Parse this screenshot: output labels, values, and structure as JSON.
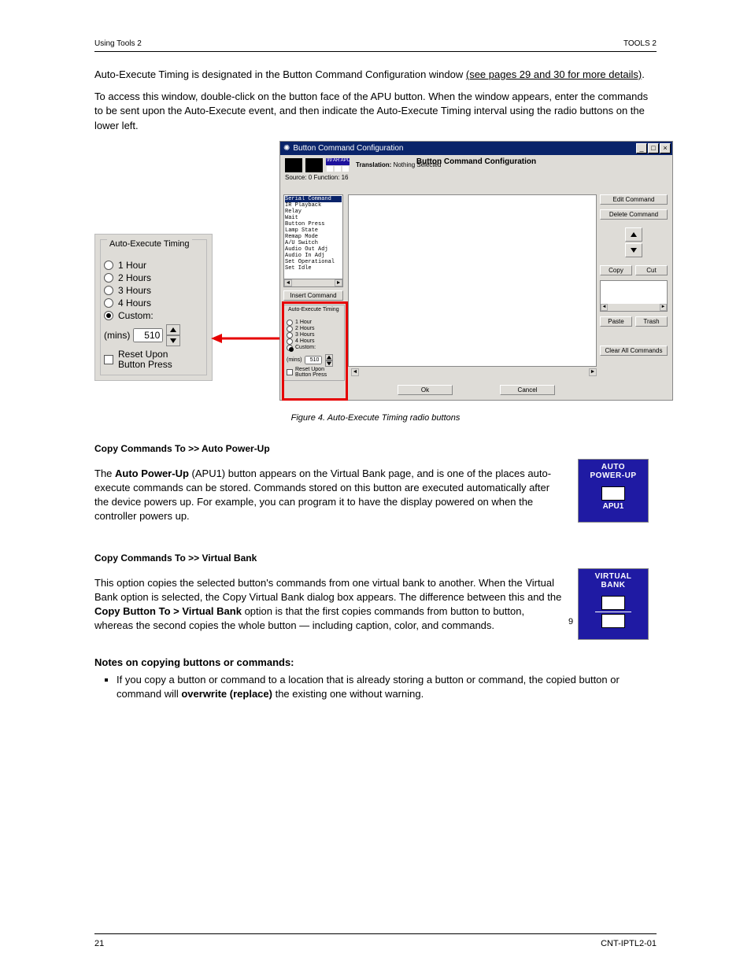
{
  "header": {
    "left": "Using Tools 2",
    "right": "TOOLS 2"
  },
  "intro": {
    "line1_pre": "Auto-Execute Timing is designated in the Button Command Configuration window ",
    "line1_link": "(see pages 29 and 30 for more details)",
    "line1_post": ".",
    "line2": "To access this window, double-click on the button face of the APU button. When the window appears, enter the commands to be sent upon the Auto-Execute event, and then indicate the Auto-Execute Timing interval using the radio buttons on the lower left."
  },
  "timing": {
    "title": "Auto-Execute Timing",
    "opts": [
      "1 Hour",
      "2 Hours",
      "3 Hours",
      "4 Hours",
      "Custom:"
    ],
    "selected": 4,
    "mins_label": "(mins)",
    "mins_value": "510",
    "reset_label": "Reset Upon\nButton Press"
  },
  "dialog": {
    "titlebar": "Button Command Configuration",
    "big_title": "Button Command Configuration",
    "sel_badge": "99 AR APU",
    "translation_label": "Translation:",
    "translation_value": "Nothing Selected",
    "subline": "Source: 0    Function: 16",
    "commands": [
      "Serial Command",
      "IR Playback",
      "Relay",
      "Wait",
      "Button Press",
      "Lamp State",
      "Remap Mode",
      "A/U Switch",
      "Audio Out Adj",
      "Audio In Adj",
      "Set Operational",
      "Set Idle"
    ],
    "insert": "Insert Command",
    "edit": "Edit Command",
    "del": "Delete Command",
    "copy": "Copy",
    "cut": "Cut",
    "paste": "Paste",
    "trash": "Trash",
    "clear": "Clear All Commands",
    "ok": "Ok",
    "cancel": "Cancel"
  },
  "fig_caption": "Figure 4. Auto-Execute Timing radio buttons",
  "sections": {
    "apu": {
      "title": "Copy Commands To >> Auto Power-Up",
      "body_pre": "The ",
      "body_mid": "Auto Power-Up",
      "body_post": " (APU1) button appears on the Virtual Bank page, and is one of the places auto-execute commands can be stored. Commands stored on this button are executed automatically after the device powers up. For example, you can program it to have the display powered on when the controller powers up.",
      "device": {
        "top1": "AUTO",
        "top2": "POWER-UP",
        "label": "APU1"
      }
    },
    "vb": {
      "title": "Copy Commands To >> Virtual Bank",
      "body_pre": "This option copies the selected button's commands from one virtual bank to another. When the Virtual Bank option is selected, the Copy Virtual Bank dialog box appears. The difference between this and the ",
      "body_mid": "Copy Button To > Virtual Bank",
      "body_post": " option is that the first copies commands from button to button, whereas the second copies the whole button — including caption, color, and commands.",
      "device": {
        "top1": "VIRTUAL",
        "top2": "BANK",
        "num": "9"
      }
    },
    "notes": {
      "title": "Notes on copying buttons or commands:",
      "bullets": [
        {
          "pre": "If you copy a button or command to a location that is already storing a button or command, the copied button or command will ",
          "b": "overwrite (replace)",
          "post": " the existing one without warning."
        }
      ]
    }
  },
  "footer": {
    "left": "21",
    "right": "CNT-IPTL2-01"
  }
}
